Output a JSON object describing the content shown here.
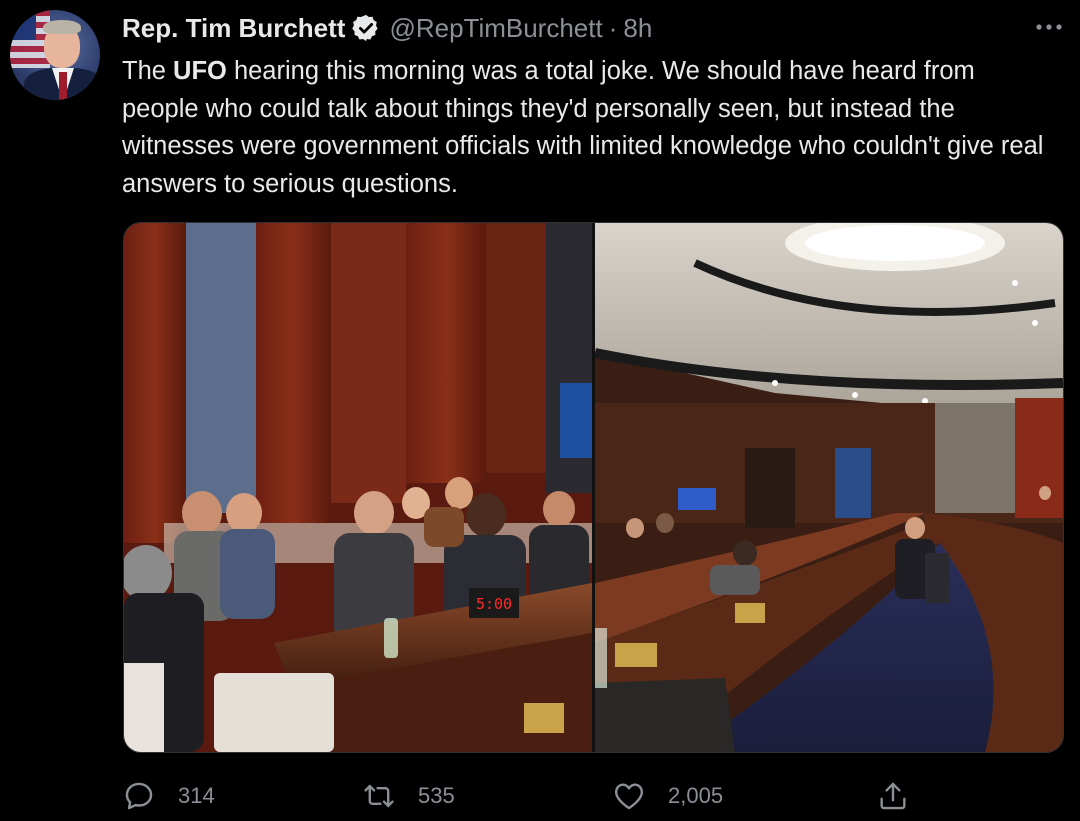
{
  "tweet": {
    "author_name": "Rep. Tim Burchett",
    "handle": "@RepTimBurchett",
    "separator": "·",
    "time": "8h",
    "text_before": "The ",
    "text_bold": "UFO",
    "text_after": " hearing this morning was a total joke. We should have heard from people who could talk about things they'd personally seen, but instead the witnesses were government officials with limited knowledge who couldn't give real answers to serious questions.",
    "timer_display": "5:00"
  },
  "actions": {
    "replies": "314",
    "retweets": "535",
    "likes": "2,005"
  },
  "icons": {
    "verified": "verified-badge-icon",
    "more": "more-dots-icon",
    "reply": "reply-bubble-icon",
    "retweet": "retweet-arrows-icon",
    "like": "heart-icon",
    "share": "share-upload-icon"
  },
  "colors": {
    "background": "#000000",
    "text_primary": "#e7e9ea",
    "text_secondary": "#8b9096",
    "border": "#2f3336"
  }
}
